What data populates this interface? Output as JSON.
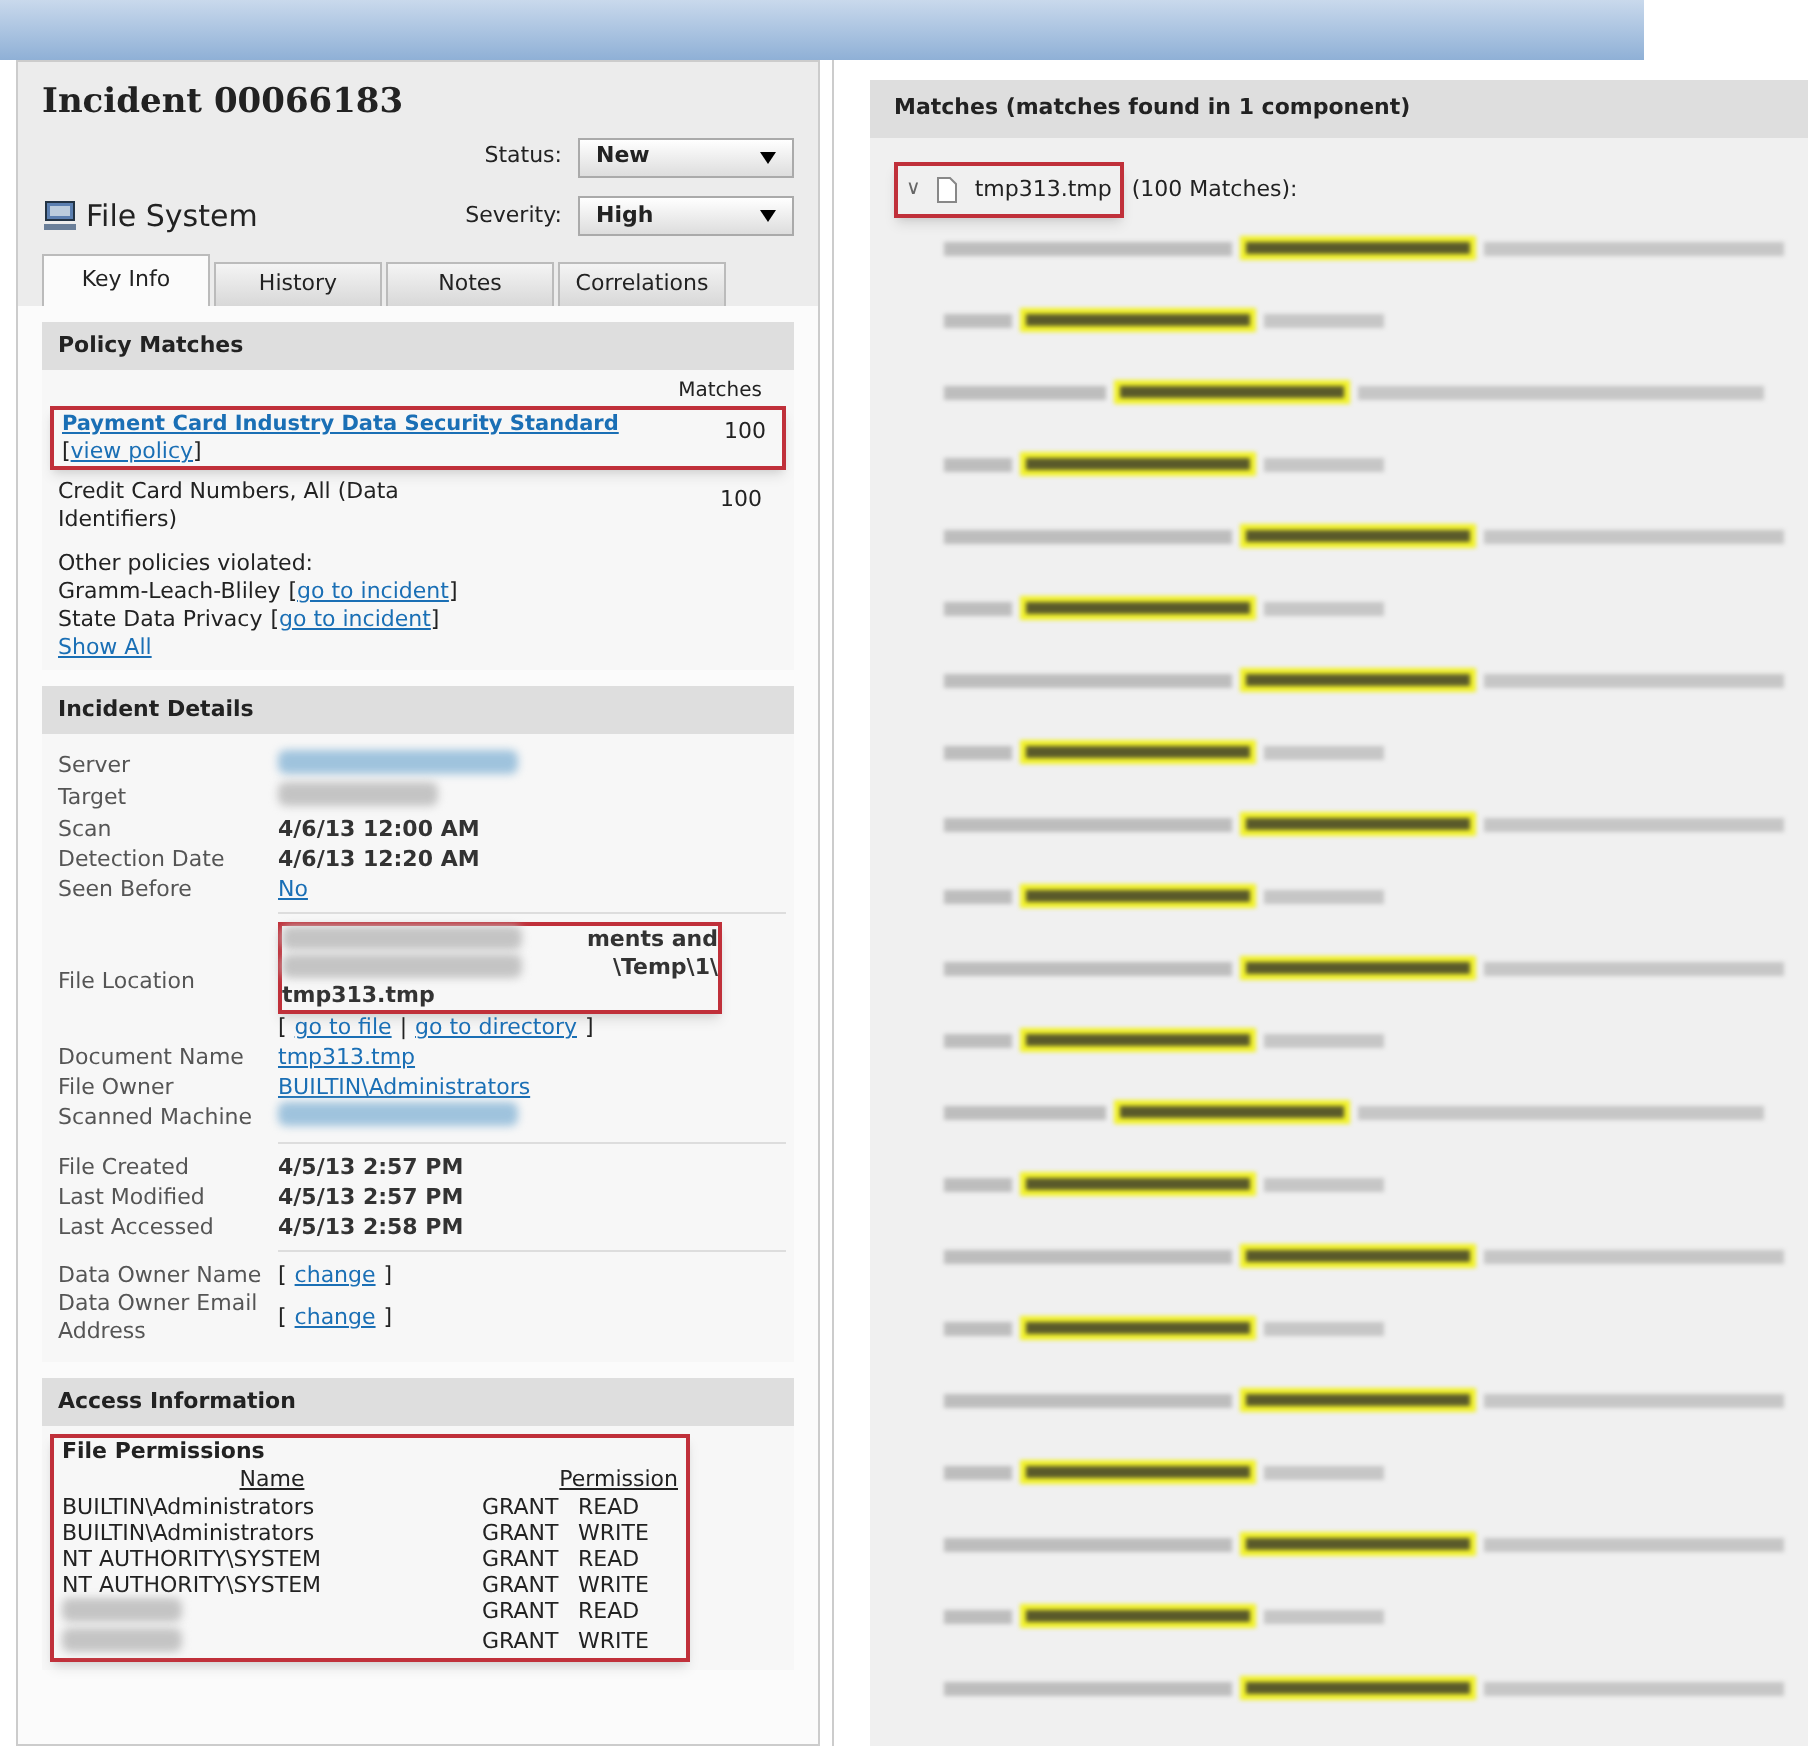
{
  "incident": {
    "title": "Incident 00066183",
    "source": "File System",
    "status": {
      "label": "Status:",
      "value": "New"
    },
    "severity": {
      "label": "Severity:",
      "value": "High"
    }
  },
  "tabs": [
    {
      "label": "Key Info",
      "selected": true
    },
    {
      "label": "History",
      "selected": false
    },
    {
      "label": "Notes",
      "selected": false
    },
    {
      "label": "Correlations",
      "selected": false
    }
  ],
  "policy_matches": {
    "title": "Policy Matches",
    "matches_heading": "Matches",
    "policies": [
      {
        "name": "Payment Card Industry Data Security Standard",
        "kind": "link",
        "action_prefix": "[",
        "action": "view policy",
        "action_suffix": "]",
        "matches": "100",
        "highlighted": true
      },
      {
        "name": "Credit Card Numbers, All (Data Identifiers)",
        "kind": "text",
        "matches": "100",
        "highlighted": false
      }
    ],
    "other_heading": "Other policies violated:",
    "other_policies": [
      {
        "name": "Gramm-Leach-Bliley",
        "prefix": "[",
        "action": "go to incident",
        "suffix": "]"
      },
      {
        "name": "State Data Privacy",
        "prefix": "[",
        "action": "go to incident",
        "suffix": "]"
      }
    ],
    "show_all": "Show All"
  },
  "incident_details": {
    "title": "Incident Details",
    "groups": [
      [
        {
          "label": "Server",
          "kind": "redacted_link"
        },
        {
          "label": "Target",
          "kind": "redacted"
        },
        {
          "label": "Scan",
          "kind": "text",
          "value": "4/6/13 12:00 AM"
        },
        {
          "label": "Detection Date",
          "kind": "text",
          "value": "4/6/13 12:20 AM"
        },
        {
          "label": "Seen Before",
          "kind": "link",
          "value": "No"
        }
      ],
      [
        {
          "label": "File Location",
          "kind": "location",
          "lines": [
            "ments and",
            "\\Temp\\1\\",
            "tmp313.tmp"
          ],
          "highlighted": true,
          "prefix": "[",
          "actions": [
            "go to file",
            "go to directory"
          ],
          "separator": "|",
          "suffix": "]"
        },
        {
          "label": "Document Name",
          "kind": "link",
          "value": "tmp313.tmp"
        },
        {
          "label": "File Owner",
          "kind": "link",
          "value": "BUILTIN\\Administrators"
        },
        {
          "label": "Scanned Machine",
          "kind": "redacted_link"
        }
      ],
      [
        {
          "label": "File Created",
          "kind": "text",
          "value": "4/5/13 2:57 PM"
        },
        {
          "label": "Last Modified",
          "kind": "text",
          "value": "4/5/13 2:57 PM"
        },
        {
          "label": "Last Accessed",
          "kind": "text",
          "value": "4/5/13 2:58 PM"
        }
      ],
      [
        {
          "label": "Data Owner Name",
          "kind": "action",
          "prefix": "[",
          "value": "change",
          "suffix": "]"
        },
        {
          "label": "Data Owner Email Address",
          "kind": "action",
          "prefix": "[",
          "value": "change",
          "suffix": "]"
        }
      ]
    ]
  },
  "access_information": {
    "title": "Access Information",
    "subtitle": "File Permissions",
    "highlighted": true,
    "columns": [
      "Name",
      "Permission"
    ],
    "rows": [
      {
        "redacted": false,
        "name": "BUILTIN\\Administrators",
        "grant": "GRANT",
        "permission": "READ"
      },
      {
        "redacted": false,
        "name": "BUILTIN\\Administrators",
        "grant": "GRANT",
        "permission": "WRITE"
      },
      {
        "redacted": false,
        "name": "NT AUTHORITY\\SYSTEM",
        "grant": "GRANT",
        "permission": "READ"
      },
      {
        "redacted": false,
        "name": "NT AUTHORITY\\SYSTEM",
        "grant": "GRANT",
        "permission": "WRITE"
      },
      {
        "redacted": true,
        "grant": "GRANT",
        "permission": "READ"
      },
      {
        "redacted": true,
        "grant": "GRANT",
        "permission": "WRITE"
      }
    ]
  },
  "matches": {
    "title": "Matches (matches found in 1 component)",
    "file": {
      "expander": "∨",
      "name": "tmp313.tmp",
      "count": "(100 Matches):",
      "expanded": true,
      "highlighted": true
    },
    "lines": [
      {
        "kind": "long"
      },
      {
        "kind": "short"
      },
      {
        "kind": "shifted"
      },
      {
        "kind": "short"
      },
      {
        "kind": "long"
      },
      {
        "kind": "short"
      },
      {
        "kind": "long"
      },
      {
        "kind": "short"
      },
      {
        "kind": "long"
      },
      {
        "kind": "short"
      },
      {
        "kind": "long"
      },
      {
        "kind": "short"
      },
      {
        "kind": "shifted"
      },
      {
        "kind": "short"
      },
      {
        "kind": "long"
      },
      {
        "kind": "short"
      },
      {
        "kind": "long"
      },
      {
        "kind": "short"
      },
      {
        "kind": "long"
      },
      {
        "kind": "short"
      },
      {
        "kind": "long"
      }
    ]
  }
}
